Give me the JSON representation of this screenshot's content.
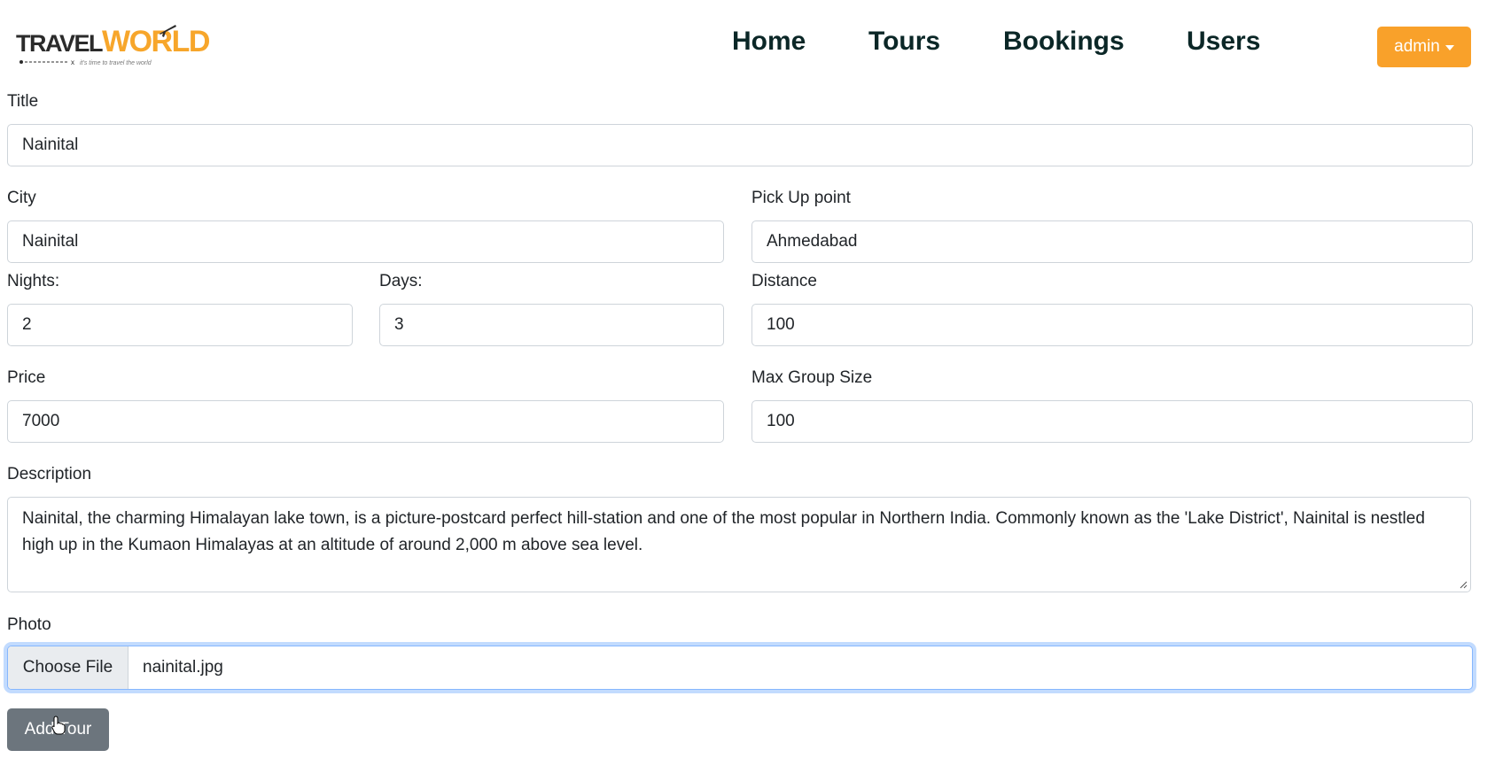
{
  "header": {
    "logo": {
      "travel": "TRAVEL",
      "world": "WORLD",
      "tagline": "it's time to travel the world"
    },
    "nav": [
      {
        "label": "Home"
      },
      {
        "label": "Tours"
      },
      {
        "label": "Bookings"
      },
      {
        "label": "Users"
      }
    ],
    "user_menu": {
      "label": "admin",
      "icon": "caret-down-icon"
    }
  },
  "form": {
    "title": {
      "label": "Title",
      "value": "Nainital"
    },
    "city": {
      "label": "City",
      "value": "Nainital"
    },
    "pickup": {
      "label": "Pick Up point",
      "value": "Ahmedabad"
    },
    "nights": {
      "label": "Nights:",
      "value": "2"
    },
    "days": {
      "label": "Days:",
      "value": "3"
    },
    "distance": {
      "label": "Distance",
      "value": "100"
    },
    "price": {
      "label": "Price",
      "value": "7000"
    },
    "max_group": {
      "label": "Max Group Size",
      "value": "100"
    },
    "description": {
      "label": "Description",
      "value": "Nainital, the charming Himalayan lake town, is a picture-postcard perfect hill-station and one of the most popular in Northern India. Commonly known as the 'Lake District', Nainital is nestled high up in the Kumaon Himalayas at an altitude of around 2,000 m above sea level."
    },
    "photo": {
      "label": "Photo",
      "button": "Choose File",
      "filename": "nainital.jpg"
    },
    "submit": "Add Tour"
  },
  "colors": {
    "accent": "#f9a12a",
    "nav_text": "#0b2727",
    "submit_bg": "#6c757d",
    "focus_border": "#86b7fe"
  }
}
